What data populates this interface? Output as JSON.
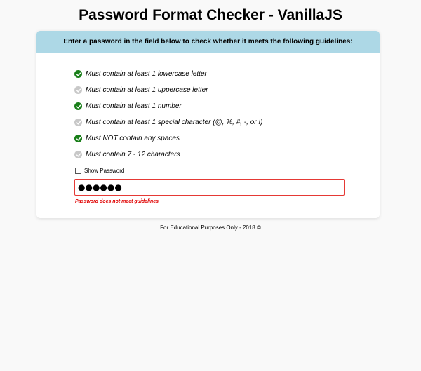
{
  "title": "Password Format Checker - VanillaJS",
  "card": {
    "instructions": "Enter a password in the field below to check whether it meets the following guidelines:",
    "header_color": "#add8e6"
  },
  "rules": [
    {
      "text": "Must contain at least 1 lowercase letter",
      "met": true
    },
    {
      "text": "Must contain at least 1 uppercase letter",
      "met": false
    },
    {
      "text": "Must contain at least 1 number",
      "met": true
    },
    {
      "text": "Must contain at least 1 special character (@, %, #, -, or !)",
      "met": false
    },
    {
      "text": "Must NOT contain any spaces",
      "met": true
    },
    {
      "text": "Must contain 7 - 12 characters",
      "met": false
    }
  ],
  "show_password": {
    "label": "Show Password",
    "checked": false
  },
  "password_field": {
    "value": "●●●●●●"
  },
  "error_message": "Password does not meet guidelines",
  "footer": "For Educational Purposes Only - 2018 ©",
  "colors": {
    "met": "#1a7f1a",
    "unmet": "#c8c8c8",
    "error": "#e00000",
    "input_border": "#e53935"
  }
}
